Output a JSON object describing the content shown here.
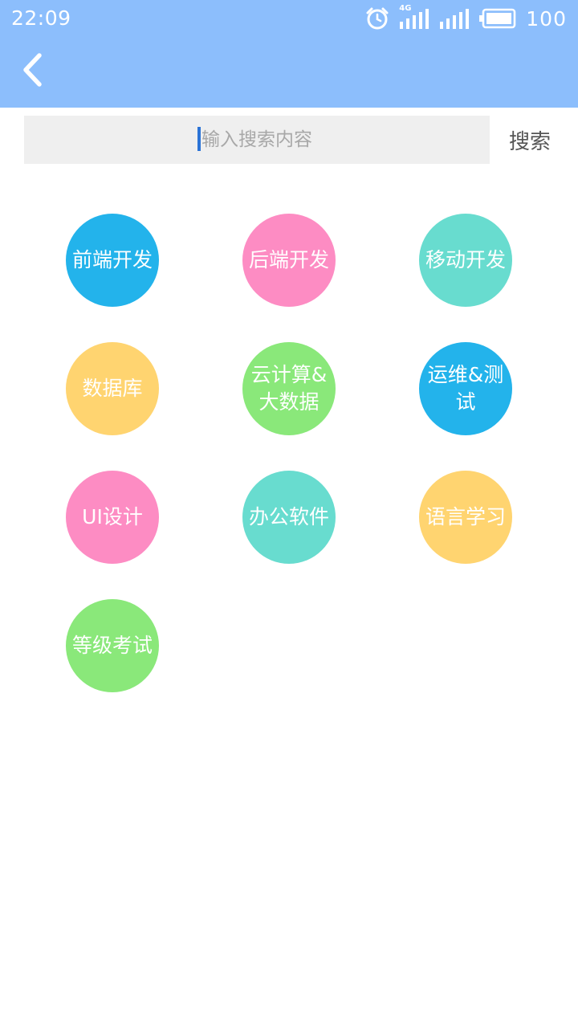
{
  "status_bar": {
    "time": "22:09",
    "network": "4G",
    "battery": "100",
    "icons": [
      "alarm-icon",
      "signal-4g-icon",
      "signal-icon",
      "battery-icon"
    ]
  },
  "app_bar": {
    "back_icon": "chevron-left-icon",
    "background_color": "#8cbefc"
  },
  "search": {
    "placeholder": "输入搜索内容",
    "value": "",
    "button_label": "搜索"
  },
  "categories": [
    {
      "label": "前端开发",
      "color": "#23b3eb"
    },
    {
      "label": "后端开发",
      "color": "#fd8cc3"
    },
    {
      "label": "移动开发",
      "color": "#68dccf"
    },
    {
      "label": "数据库",
      "color": "#ffd470"
    },
    {
      "label": "云计算&大数据",
      "color": "#8ae87a"
    },
    {
      "label": "运维&测试",
      "color": "#23b3eb"
    },
    {
      "label": "UI设计",
      "color": "#fd8cc3"
    },
    {
      "label": "办公软件",
      "color": "#68dccf"
    },
    {
      "label": "语言学习",
      "color": "#ffd470"
    },
    {
      "label": "等级考试",
      "color": "#8ae87a"
    }
  ]
}
